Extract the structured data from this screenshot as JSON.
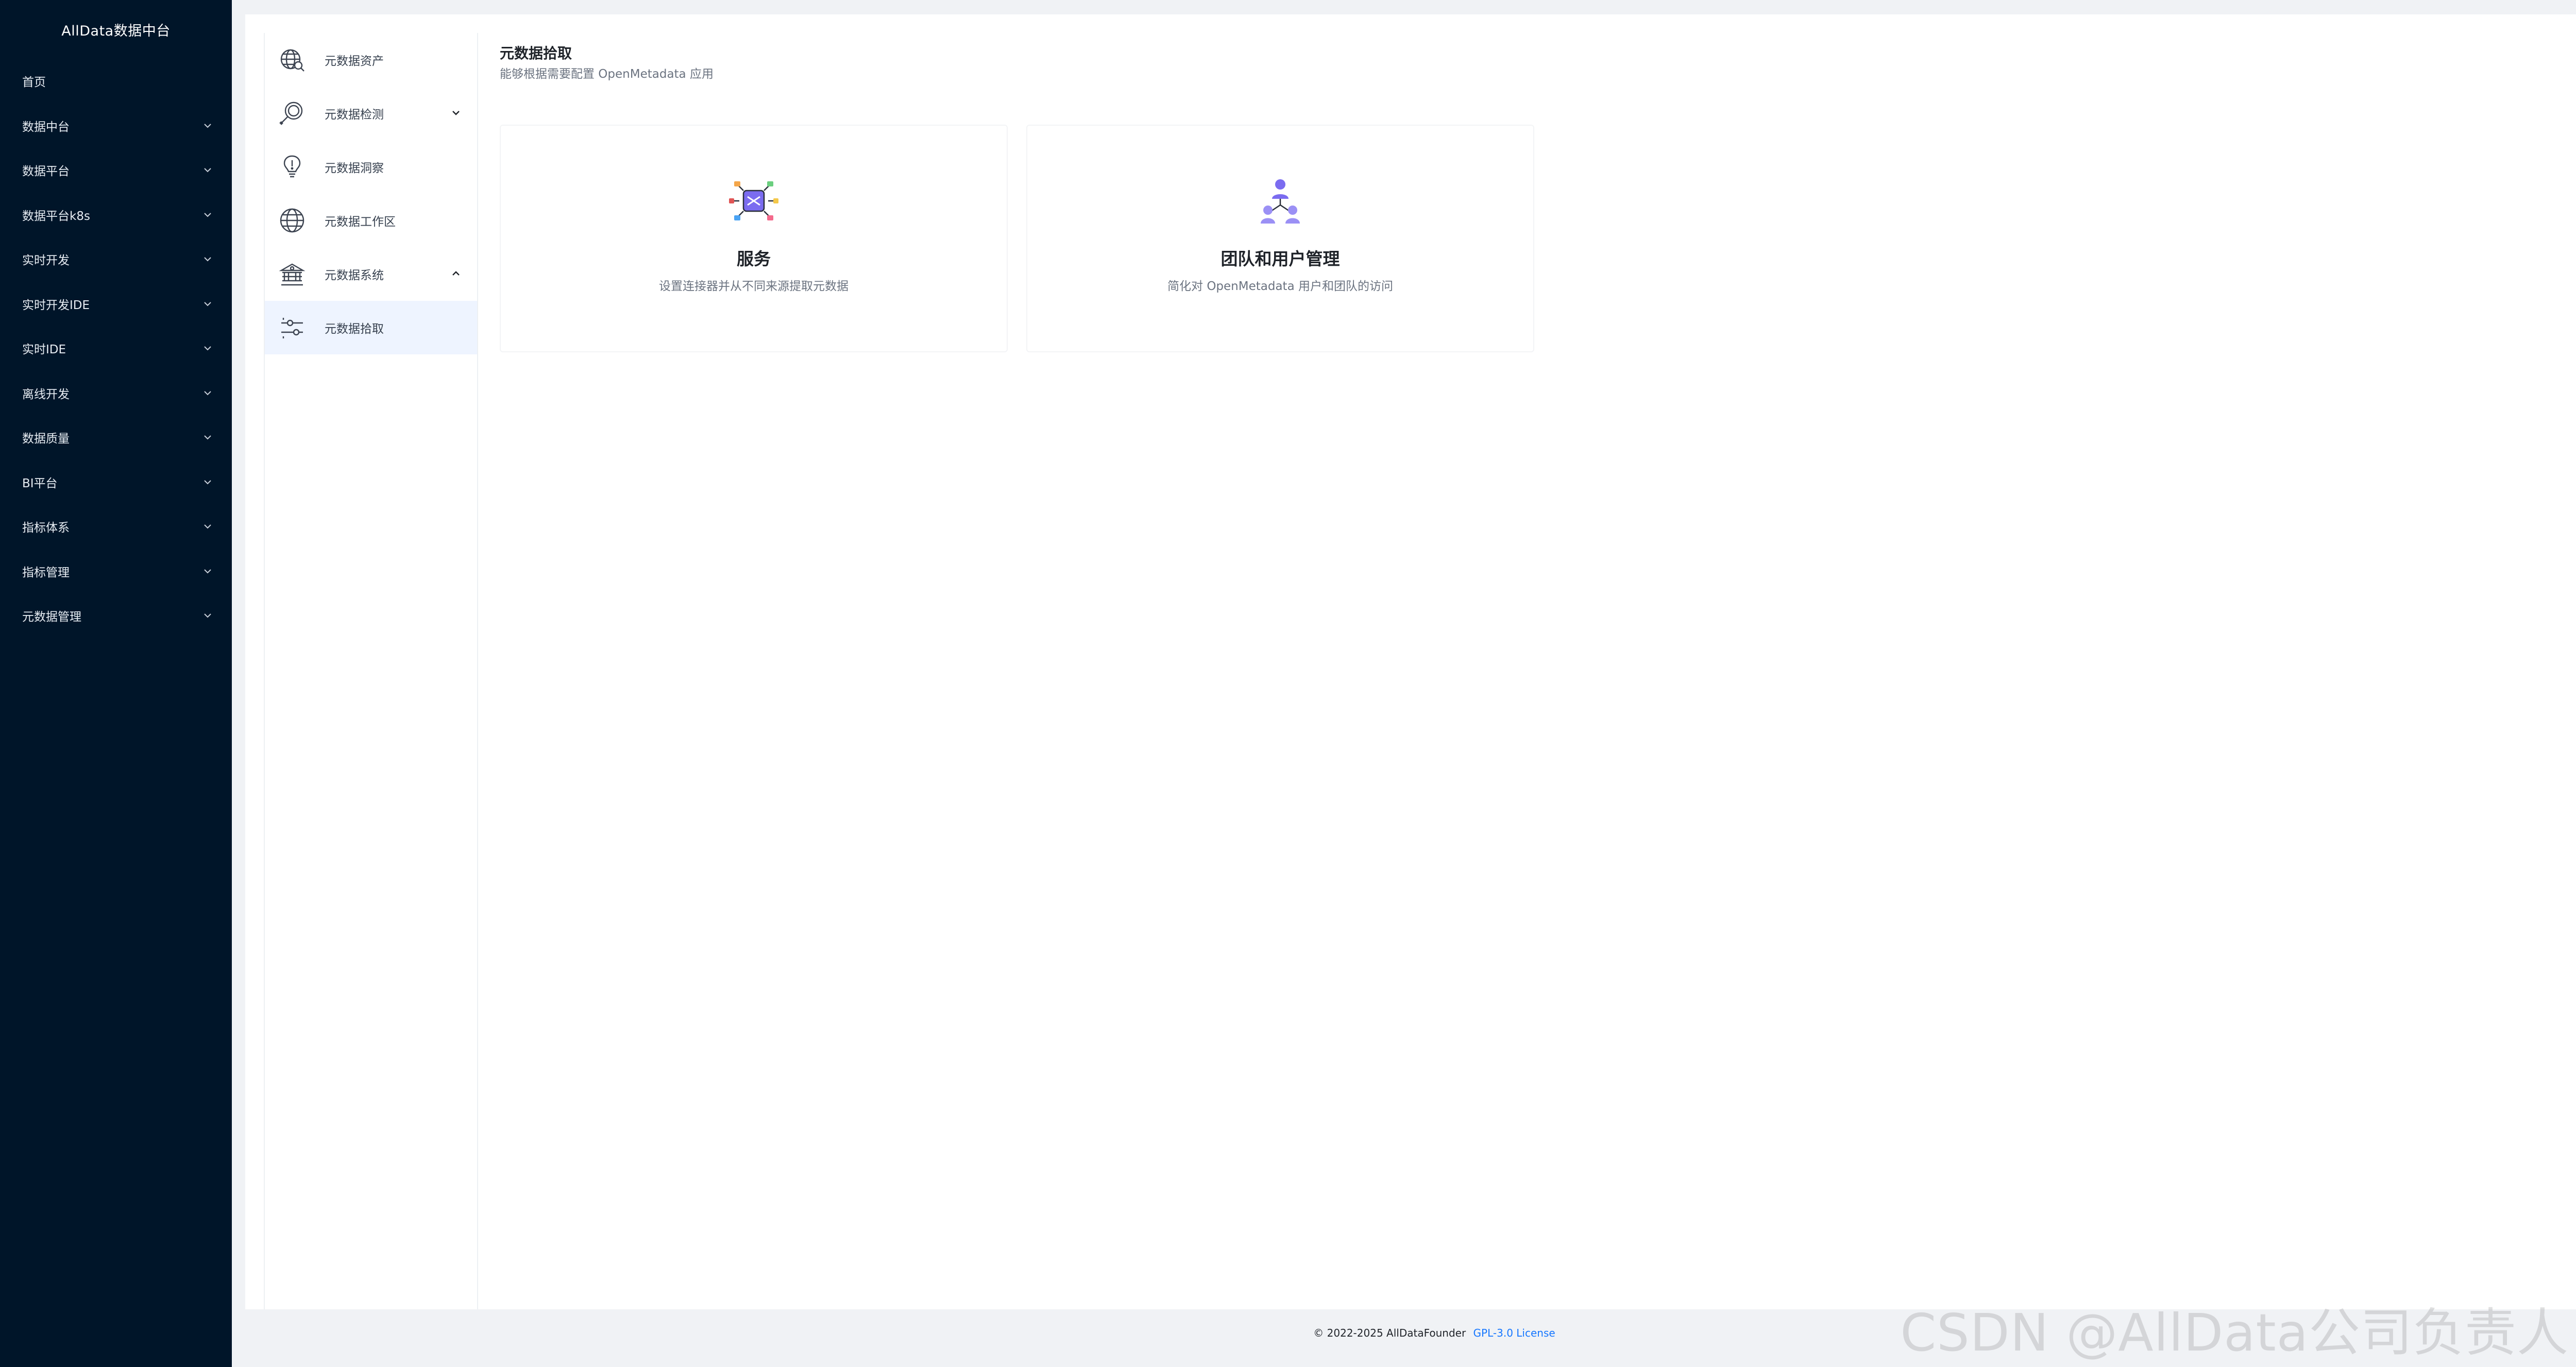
{
  "brand": {
    "title": "AllData数据中台"
  },
  "sidebar": {
    "items": [
      {
        "label": "首页",
        "has_chevron": false
      },
      {
        "label": "数据中台",
        "has_chevron": true
      },
      {
        "label": "数据平台",
        "has_chevron": true
      },
      {
        "label": "数据平台k8s",
        "has_chevron": true
      },
      {
        "label": "实时开发",
        "has_chevron": true
      },
      {
        "label": "实时开发IDE",
        "has_chevron": true
      },
      {
        "label": "实时IDE",
        "has_chevron": true
      },
      {
        "label": "离线开发",
        "has_chevron": true
      },
      {
        "label": "数据质量",
        "has_chevron": true
      },
      {
        "label": "BI平台",
        "has_chevron": true
      },
      {
        "label": "指标体系",
        "has_chevron": true
      },
      {
        "label": "指标管理",
        "has_chevron": true
      },
      {
        "label": "元数据管理",
        "has_chevron": true
      }
    ]
  },
  "subnav": {
    "items": [
      {
        "label": "元数据资产",
        "icon": "globe-search-icon"
      },
      {
        "label": "元数据检测",
        "icon": "magnifier-icon",
        "chevron": "down"
      },
      {
        "label": "元数据洞察",
        "icon": "lightbulb-icon"
      },
      {
        "label": "元数据工作区",
        "icon": "globe-icon"
      },
      {
        "label": "元数据系统",
        "icon": "building-gear-icon",
        "chevron": "up"
      },
      {
        "label": "元数据拾取",
        "icon": "sliders-icon",
        "active": true
      }
    ]
  },
  "main": {
    "title": "元数据拾取",
    "subtitle": "能够根据需要配置 OpenMetadata 应用",
    "cards": [
      {
        "title": "服务",
        "description": "设置连接器并从不同来源提取元数据",
        "icon": "connector-hub-icon"
      },
      {
        "title": "团队和用户管理",
        "description": "简化对 OpenMetadata 用户和团队的访问",
        "icon": "team-users-icon"
      }
    ]
  },
  "footer": {
    "copyright": "© 2022-2025 AllDataFounder",
    "license_link": "GPL-3.0 License"
  },
  "watermark": "CSDN @AllData公司负责人",
  "colors": {
    "sidebar_bg": "#001529",
    "accent": "#1677ff",
    "active_bg": "#eef4ff",
    "icon_purple": "#7b6cf0"
  }
}
